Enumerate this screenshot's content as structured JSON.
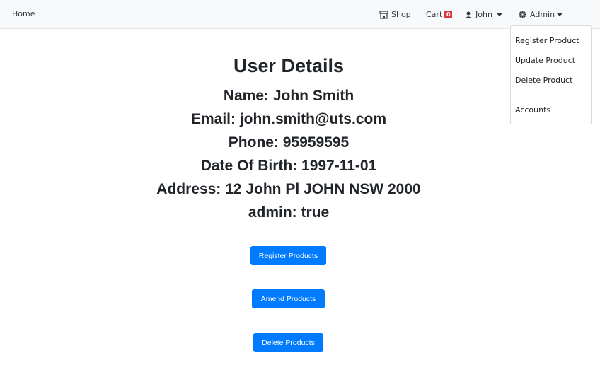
{
  "navbar": {
    "home": "Home",
    "shop": "Shop",
    "cart": "Cart",
    "cart_count": "0",
    "user": "John",
    "admin": "Admin"
  },
  "admin_menu": {
    "items": [
      "Register Product",
      "Update Product",
      "Delete Product"
    ],
    "accounts": "Accounts"
  },
  "user_details": {
    "title": "User Details",
    "name": "Name: John Smith",
    "email": "Email: john.smith@uts.com",
    "phone": "Phone: 95959595",
    "dob": "Date Of Birth: 1997-11-01",
    "address": "Address: 12 John Pl JOHN NSW 2000",
    "admin": "admin: true"
  },
  "buttons": {
    "register": "Register Products",
    "amend": "Amend Products",
    "delete": "Delete Products"
  },
  "colors": {
    "primary": "#007bff",
    "badge": "#dc3545",
    "navbar_bg": "#f8f9fa"
  }
}
